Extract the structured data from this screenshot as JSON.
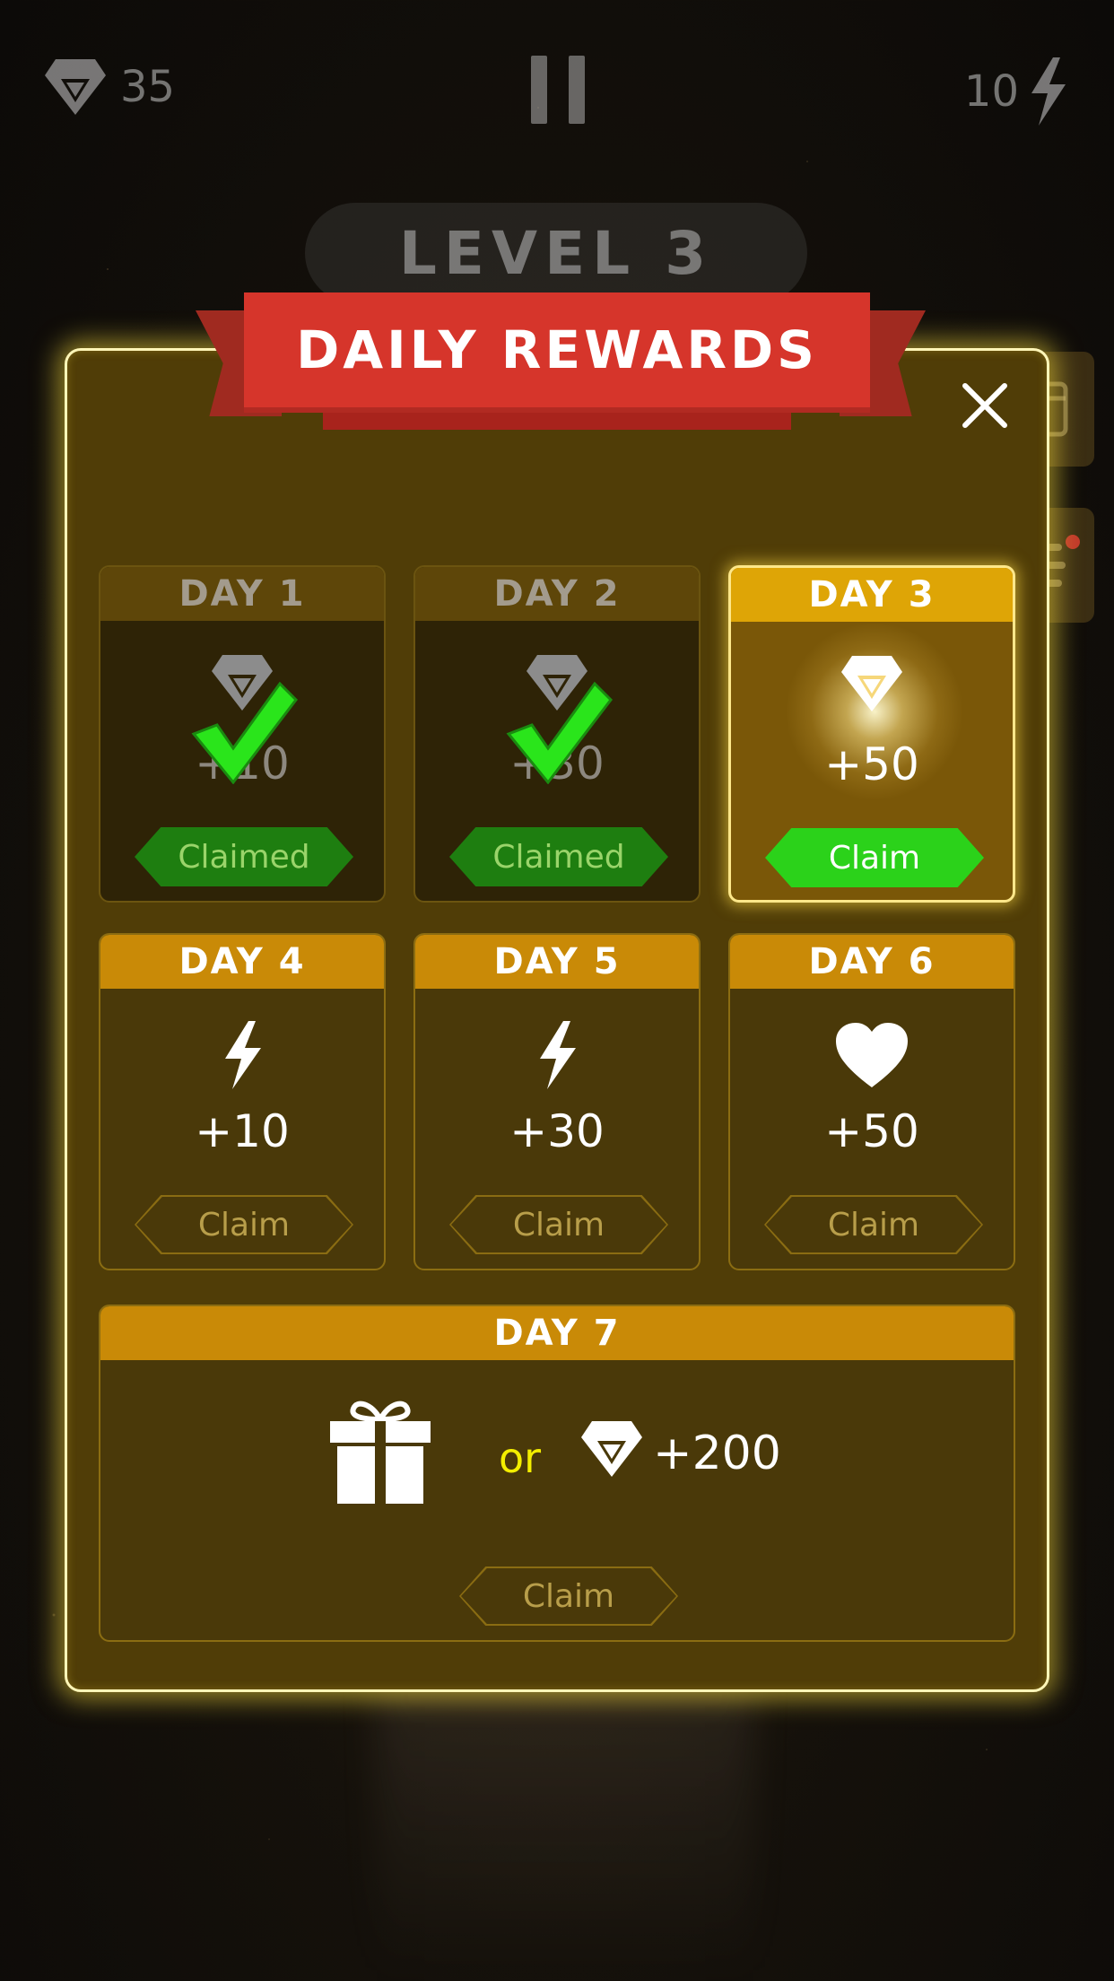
{
  "hud": {
    "gems": "35",
    "energy": "10",
    "gem_icon": "diamond-icon",
    "energy_icon": "lightning-icon",
    "pause_icon": "pause-icon"
  },
  "level": "LEVEL 3",
  "dialog": {
    "title": "DAILY REWARDS",
    "close_icon": "close-icon"
  },
  "days": [
    {
      "label": "DAY 1",
      "reward": "+10",
      "icon": "diamond-icon",
      "button": "Claimed",
      "state": "claimed"
    },
    {
      "label": "DAY 2",
      "reward": "+30",
      "icon": "diamond-icon",
      "button": "Claimed",
      "state": "claimed"
    },
    {
      "label": "DAY 3",
      "reward": "+50",
      "icon": "diamond-icon",
      "button": "Claim",
      "state": "current"
    },
    {
      "label": "DAY 4",
      "reward": "+10",
      "icon": "lightning-icon",
      "button": "Claim",
      "state": "locked"
    },
    {
      "label": "DAY 5",
      "reward": "+30",
      "icon": "lightning-icon",
      "button": "Claim",
      "state": "locked"
    },
    {
      "label": "DAY 6",
      "reward": "+50",
      "icon": "heart-icon",
      "button": "Claim",
      "state": "locked"
    }
  ],
  "day7": {
    "label": "DAY 7",
    "gift_icon": "gift-icon",
    "or": "or",
    "reward": "+200",
    "button": "Claim"
  },
  "colors": {
    "accent": "#d6352b",
    "claim_active": "#2bd21a",
    "claimed": "#1e7e10",
    "card_header": "#c98a07",
    "current_header": "#dea506",
    "glow": "#ffe23c"
  }
}
